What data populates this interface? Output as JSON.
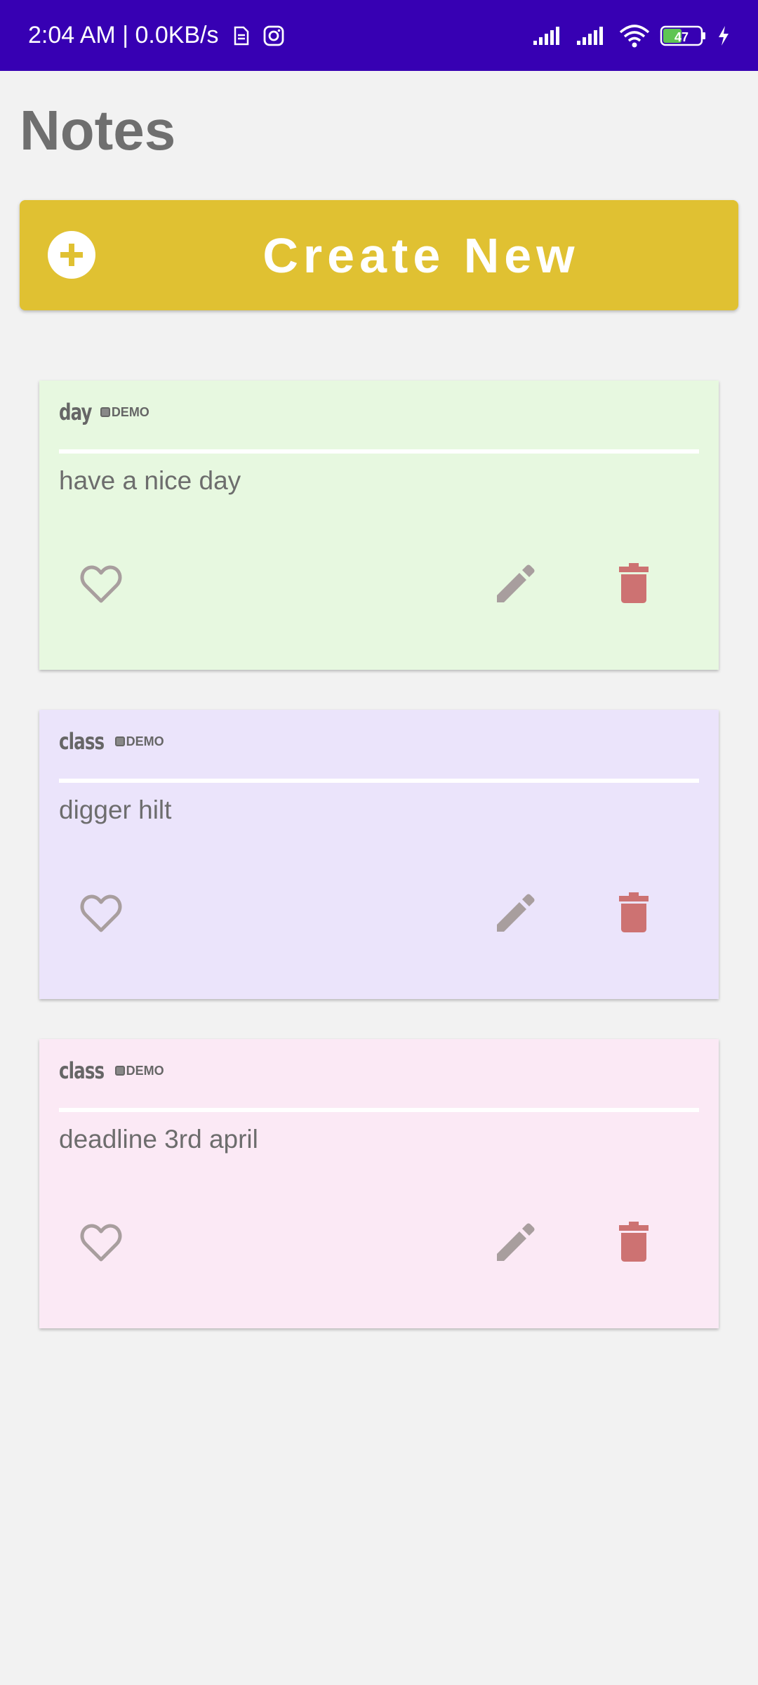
{
  "status_bar": {
    "time_network": "2:04 AM | 0.0KB/s",
    "battery_level": "47",
    "icons": [
      "sim-icon",
      "instagram-icon",
      "signal-icon",
      "signal-icon",
      "wifi-icon",
      "battery-icon",
      "charging-icon"
    ]
  },
  "page": {
    "title": "Notes"
  },
  "create_button": {
    "label": "Create New",
    "icon": "plus-circle-icon",
    "color": "#e0c132"
  },
  "notes": [
    {
      "title": "day",
      "demo": "DEMO",
      "body": "have a nice day",
      "background": "#e7f8e0",
      "icons": [
        "heart-outline-icon",
        "pencil-icon",
        "trash-icon"
      ]
    },
    {
      "title": "class",
      "demo": "DEMO",
      "body": "digger hilt",
      "background": "#ebe4fb",
      "icons": [
        "heart-outline-icon",
        "pencil-icon",
        "trash-icon"
      ]
    },
    {
      "title": "class",
      "demo": "DEMO",
      "body": "deadline 3rd april",
      "background": "#fbe9f5",
      "icons": [
        "heart-outline-icon",
        "pencil-icon",
        "trash-icon"
      ]
    }
  ],
  "colors": {
    "status_bar": "#3700b3",
    "page_background": "#f2f2f2",
    "delete": "#cd7272",
    "edit": "#a89e9e",
    "heart": "#a89e9e"
  }
}
